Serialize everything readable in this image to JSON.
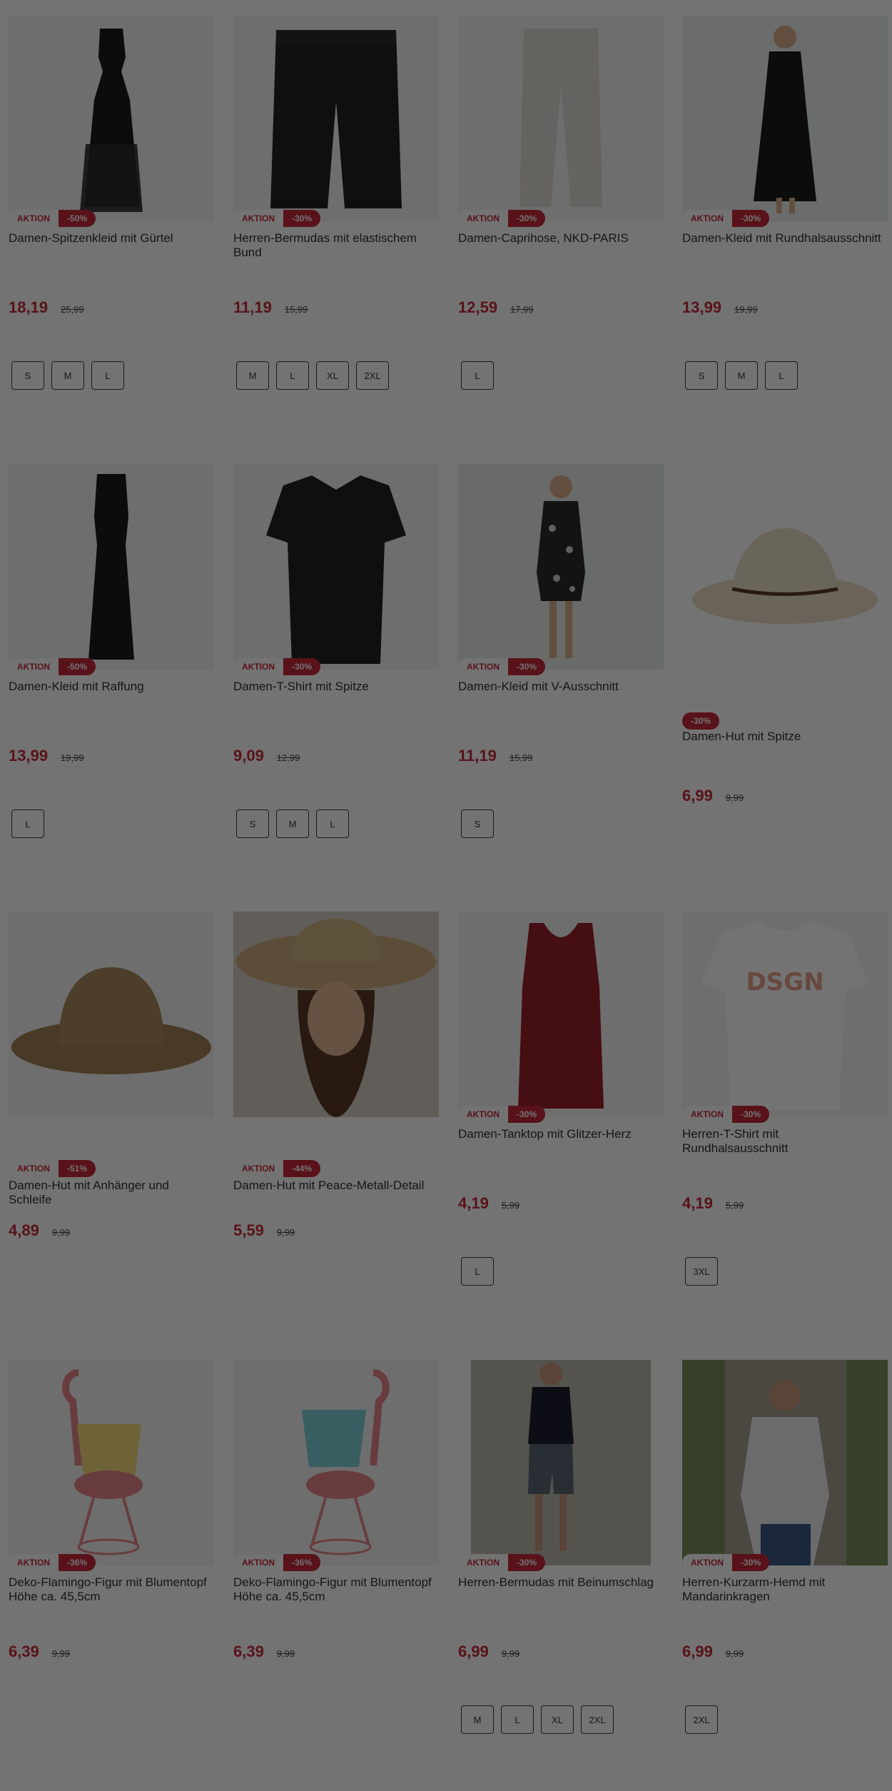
{
  "labels": {
    "aktion": "AKTION"
  },
  "colors": {
    "accent": "#c6283a",
    "overlay": "rgba(0,0,0,0.55)"
  },
  "products": [
    {
      "name": "Damen-Spitzenkleid mit Gürtel",
      "badge_aktion": true,
      "discount": "-50%",
      "price": "18,19",
      "old_price": "25,99",
      "sizes": [
        "S",
        "M",
        "L"
      ],
      "icon": "lace-dress-image"
    },
    {
      "name": "Herren-Bermudas mit elastischem Bund",
      "badge_aktion": true,
      "discount": "-30%",
      "price": "11,19",
      "old_price": "15,99",
      "sizes": [
        "M",
        "L",
        "XL",
        "2XL"
      ],
      "icon": "bermuda-shorts-image"
    },
    {
      "name": "Damen-Caprihose, NKD-PARIS",
      "badge_aktion": true,
      "discount": "-30%",
      "price": "12,59",
      "old_price": "17,99",
      "sizes": [
        "L"
      ],
      "icon": "capri-pants-image"
    },
    {
      "name": "Damen-Kleid mit Rundhalsausschnitt",
      "badge_aktion": true,
      "discount": "-30%",
      "price": "13,99",
      "old_price": "19,99",
      "sizes": [
        "S",
        "M",
        "L"
      ],
      "icon": "model-dress-image"
    },
    {
      "name": "Damen-Kleid mit Raffung",
      "badge_aktion": true,
      "discount": "-50%",
      "price": "13,99",
      "old_price": "19,99",
      "sizes": [
        "L"
      ],
      "icon": "maxi-dress-image"
    },
    {
      "name": "Damen-T-Shirt mit Spitze",
      "badge_aktion": true,
      "discount": "-30%",
      "price": "9,09",
      "old_price": "12,99",
      "sizes": [
        "S",
        "M",
        "L"
      ],
      "icon": "tshirt-image"
    },
    {
      "name": "Damen-Kleid mit V-Ausschnitt",
      "badge_aktion": true,
      "discount": "-30%",
      "price": "11,19",
      "old_price": "15,99",
      "sizes": [
        "S"
      ],
      "icon": "floral-dress-image"
    },
    {
      "name": "Damen-Hut mit Spitze",
      "badge_aktion": false,
      "discount": "-30%",
      "price": "6,99",
      "old_price": "9,99",
      "sizes": [],
      "icon": "fedora-hat-image"
    },
    {
      "name": "Damen-Hut mit Anhänger und Schleife",
      "badge_aktion": true,
      "discount": "-51%",
      "price": "4,89",
      "old_price": "9,99",
      "sizes": [],
      "icon": "straw-hat-image"
    },
    {
      "name": "Damen-Hut mit Peace-Metall-Detail",
      "badge_aktion": true,
      "discount": "-44%",
      "price": "5,59",
      "old_price": "9,99",
      "sizes": [],
      "icon": "woman-hat-image"
    },
    {
      "name": "Damen-Tanktop mit Glitzer-Herz",
      "badge_aktion": true,
      "discount": "-30%",
      "price": "4,19",
      "old_price": "5,99",
      "sizes": [
        "L"
      ],
      "icon": "tank-top-image"
    },
    {
      "name": "Herren-T-Shirt mit Rundhalsausschnitt",
      "badge_aktion": true,
      "discount": "-30%",
      "price": "4,19",
      "old_price": "5,99",
      "sizes": [
        "3XL"
      ],
      "icon": "dsgn-tshirt-image"
    },
    {
      "name": "Deko-Flamingo-Figur mit Blumentopf Höhe ca. 45,5cm",
      "badge_aktion": true,
      "discount": "-36%",
      "price": "6,39",
      "old_price": "9,99",
      "sizes": [],
      "icon": "flamingo-yellow-image"
    },
    {
      "name": "Deko-Flamingo-Figur mit Blumentopf Höhe ca. 45,5cm",
      "badge_aktion": true,
      "discount": "-36%",
      "price": "6,39",
      "old_price": "9,99",
      "sizes": [],
      "icon": "flamingo-blue-image"
    },
    {
      "name": "Herren-Bermudas mit Beinumschlag",
      "badge_aktion": true,
      "discount": "-30%",
      "price": "6,99",
      "old_price": "9,99",
      "sizes": [
        "M",
        "L",
        "XL",
        "2XL"
      ],
      "icon": "man-bermuda-image"
    },
    {
      "name": "Herren-Kurzarm-Hemd mit Mandarinkragen",
      "badge_aktion": true,
      "discount": "-30%",
      "price": "6,99",
      "old_price": "9,99",
      "sizes": [
        "2XL"
      ],
      "icon": "man-shirt-image"
    }
  ]
}
